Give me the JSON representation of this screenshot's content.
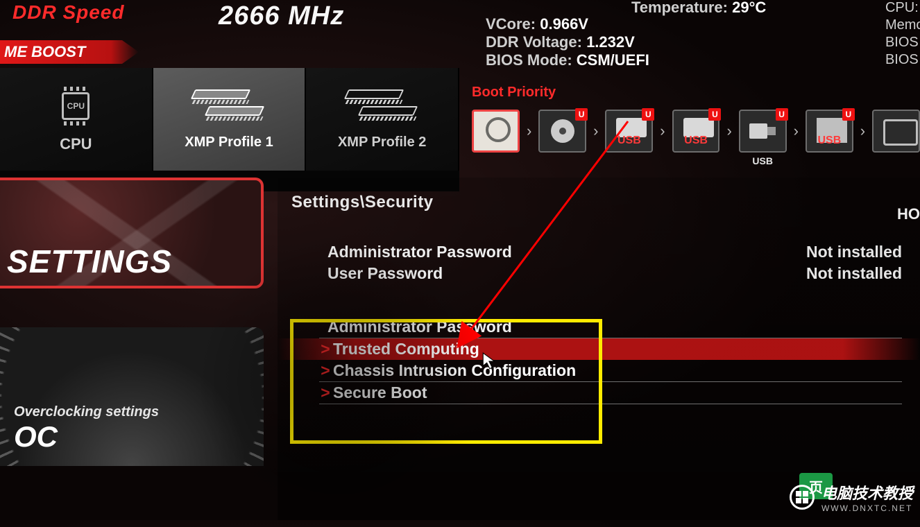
{
  "header": {
    "ddr_label": "DDR Speed",
    "ddr_value": "2666 MHz",
    "game_boost": "ME BOOST"
  },
  "profiles": {
    "cpu": "CPU",
    "xmp1": "XMP Profile 1",
    "xmp2": "XMP Profile 2"
  },
  "sysinfo": {
    "temp_key": "Temperature:",
    "temp_val": "29°C",
    "vcore_key": "VCore:",
    "vcore_val": "0.966V",
    "ddrv_key": "DDR Voltage:",
    "ddrv_val": "1.232V",
    "biosmode_key": "BIOS Mode:",
    "biosmode_val": "CSM/UEFI"
  },
  "right_info": {
    "cpu": "CPU: In",
    "memory": "Memo",
    "biosv": "BIOS V",
    "biosb": "BIOS B"
  },
  "boot_priority": {
    "title": "Boot Priority",
    "devices": [
      "HDD",
      "CD",
      "USB",
      "USB",
      "USB",
      "USB",
      "NIC"
    ],
    "usb_sub": "USB"
  },
  "sidebar": {
    "settings": "SETTINGS",
    "oc_sub": "Overclocking settings",
    "oc": "OC"
  },
  "main": {
    "breadcrumb": "Settings\\Security",
    "right_hint": "HO",
    "rows": [
      {
        "label": "Administrator Password",
        "value": "Not installed"
      },
      {
        "label": "User Password",
        "value": "Not installed"
      }
    ],
    "section_head": "Administrator Password",
    "submenu": [
      "Trusted Computing",
      "Chassis Intrusion Configuration",
      "Secure Boot"
    ]
  },
  "watermark": {
    "text1": "电脑技术教授",
    "text2": "WWW.DNXTC.NET"
  }
}
